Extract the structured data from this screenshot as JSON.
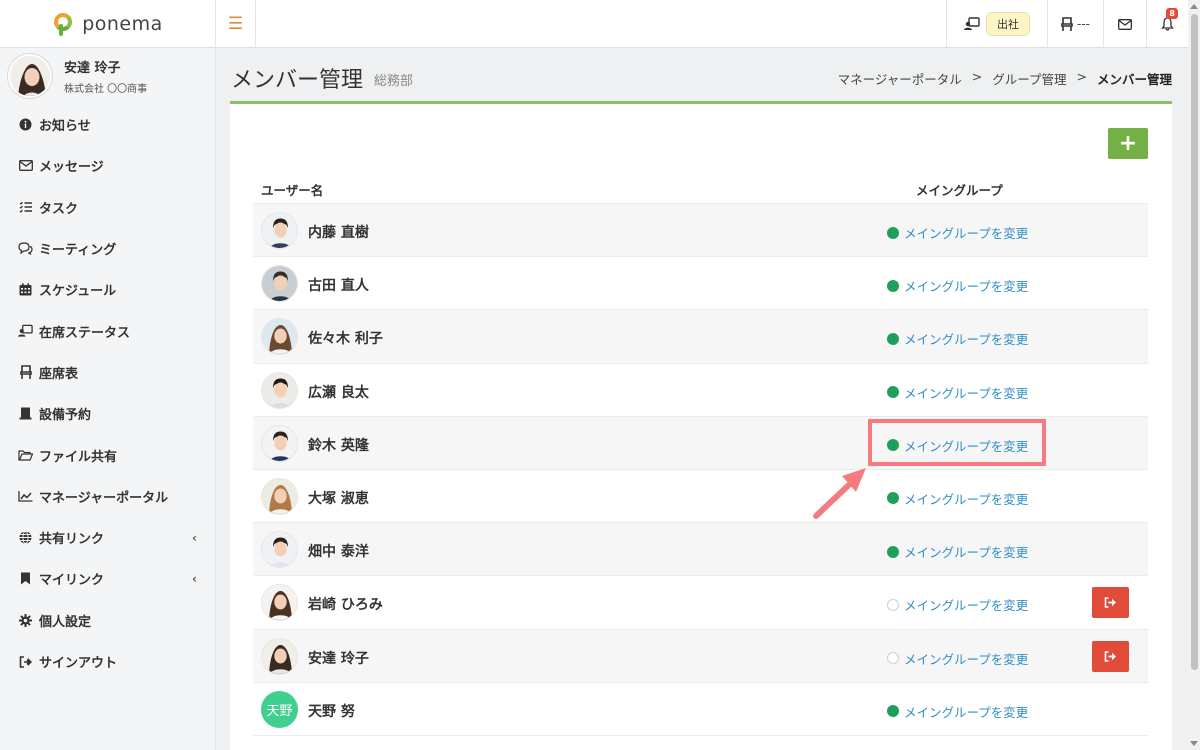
{
  "app": {
    "brand": "ponema"
  },
  "topbar": {
    "status_label": "出社",
    "seat_label": "---",
    "notification_count": "8"
  },
  "sidebar": {
    "user": {
      "name": "安達 玲子",
      "company": "株式会社 〇〇商事"
    },
    "items": [
      {
        "label": "お知らせ",
        "icon": "info-icon"
      },
      {
        "label": "メッセージ",
        "icon": "envelope-icon"
      },
      {
        "label": "タスク",
        "icon": "list-icon"
      },
      {
        "label": "ミーティング",
        "icon": "chat-icon"
      },
      {
        "label": "スケジュール",
        "icon": "calendar-icon"
      },
      {
        "label": "在席ステータス",
        "icon": "presence-icon"
      },
      {
        "label": "座席表",
        "icon": "chair-icon"
      },
      {
        "label": "設備予約",
        "icon": "equipment-icon"
      },
      {
        "label": "ファイル共有",
        "icon": "folder-icon"
      },
      {
        "label": "マネージャーポータル",
        "icon": "chart-icon"
      },
      {
        "label": "共有リンク",
        "icon": "globe-icon",
        "caret": "‹"
      },
      {
        "label": "マイリンク",
        "icon": "bookmark-icon",
        "caret": "‹"
      },
      {
        "label": "個人設定",
        "icon": "gear-icon"
      },
      {
        "label": "サインアウト",
        "icon": "signout-icon"
      }
    ]
  },
  "header": {
    "title": "メンバー管理",
    "subtitle": "総務部",
    "breadcrumb": [
      "マネージャーポータル",
      "グループ管理",
      "メンバー管理"
    ],
    "separator": ">"
  },
  "table": {
    "col_user": "ユーザー名",
    "col_group": "メイングループ",
    "add_label": "+",
    "change_label": "メイングループを変更",
    "rows": [
      {
        "name": "内藤 直樹",
        "main": true,
        "exit": false
      },
      {
        "name": "古田 直人",
        "main": true,
        "exit": false
      },
      {
        "name": "佐々木 利子",
        "main": true,
        "exit": false
      },
      {
        "name": "広瀬 良太",
        "main": true,
        "exit": false
      },
      {
        "name": "鈴木 英隆",
        "main": true,
        "exit": false
      },
      {
        "name": "大塚 淑恵",
        "main": true,
        "exit": false
      },
      {
        "name": "畑中 泰洋",
        "main": true,
        "exit": false
      },
      {
        "name": "岩崎 ひろみ",
        "main": false,
        "exit": true
      },
      {
        "name": "安達 玲子",
        "main": false,
        "exit": true
      },
      {
        "name": "天野 努",
        "main": true,
        "exit": false,
        "initials": "天野"
      }
    ]
  },
  "colors": {
    "accent_green": "#74b043",
    "link_blue": "#2f8fc5",
    "danger_red": "#e04b3a",
    "highlight_pink": "#f47c80"
  }
}
